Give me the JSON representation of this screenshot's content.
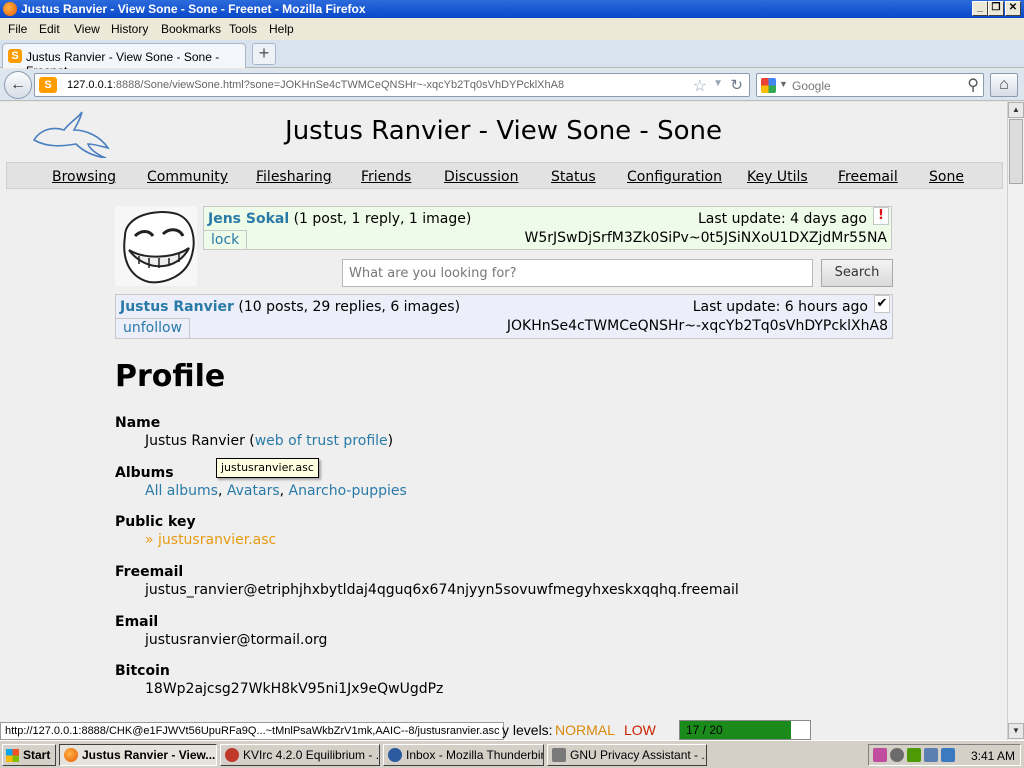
{
  "window": {
    "title": "Justus Ranvier - View Sone - Sone - Freenet - Mozilla Firefox"
  },
  "menu": [
    "File",
    "Edit",
    "View",
    "History",
    "Bookmarks",
    "Tools",
    "Help"
  ],
  "tab": {
    "label": "Justus Ranvier - View Sone - Sone - Freenet"
  },
  "navbar": {
    "url_host": "127.0.0.1",
    "url_rest": ":8888/Sone/viewSone.html?sone=JOKHnSe4cTWMCeQNSHr~-xqcYb2Tq0sVhDYPcklXhA8",
    "search_placeholder": "Google"
  },
  "page": {
    "title": "Justus Ranvier - View Sone - Sone",
    "nav": [
      "Browsing",
      "Community",
      "Filesharing",
      "Friends",
      "Discussion",
      "Status",
      "Configuration",
      "Key Utils",
      "Freemail",
      "Sone"
    ],
    "current_sone": {
      "name": "Jens Sokal",
      "stats": " (1 post, 1 reply, 1 image)",
      "last_update": "Last update: 4 days ago",
      "key": "W5rJSwDjSrfM3Zk0SiPv~0t5JSiNXoU1DXZjdMr55NA",
      "action": "lock",
      "flag": "!"
    },
    "search": {
      "placeholder": "What are you looking for?",
      "button": "Search"
    },
    "viewed_sone": {
      "name": "Justus Ranvier",
      "stats": " (10 posts, 29 replies, 6 images)",
      "last_update": "Last update: 6 hours ago",
      "key": "JOKHnSe4cTWMCeQNSHr~-xqcYb2Tq0sVhDYPcklXhA8",
      "action": "unfollow",
      "flag": "✔"
    },
    "profile": {
      "heading": "Profile",
      "name_label": "Name",
      "name_value": "Justus Ranvier (",
      "name_link": "web of trust profile",
      "name_close": ")",
      "albums_label": "Albums",
      "albums": [
        "All albums",
        "Avatars",
        "Anarcho-puppies"
      ],
      "pubkey_label": "Public key",
      "pubkey_link": "» justusranvier.asc",
      "tooltip": "justusranvier.asc",
      "freemail_label": "Freemail",
      "freemail_value": "justus_ranvier@etriphjhxbytldaj4qguq6x674njyyn5sovuwfmegyhxeskxqqhq.freemail",
      "email_label": "Email",
      "email_value": "justusranvier@tormail.org",
      "bitcoin_label": "Bitcoin",
      "bitcoin_value": "18Wp2ajcsg27WkH8kV95ni1Jx9eQwUgdPz"
    }
  },
  "status": {
    "link_url": "http://127.0.0.1:8888/CHK@e1FJWVt56UpuRFa9Q...~tMnlPsaWkbZrV1mk,AAIC--8/justusranvier.asc",
    "levels_label": "y levels:",
    "normal": "NORMAL",
    "low": "LOW",
    "peers": "17 / 20",
    "peers_fraction": 0.85
  },
  "taskbar": {
    "start": "Start",
    "tasks": [
      "Justus Ranvier - View...",
      "KVIrc 4.2.0 Equilibrium - ...",
      "Inbox - Mozilla Thunderbird",
      "GNU Privacy Assistant - ..."
    ],
    "clock": "3:41 AM"
  },
  "colors": {
    "link": "#2a7aa8",
    "own_sone_bg": "#eefbe8",
    "viewed_sone_bg": "#eceef9",
    "progress": "#1a8a1a"
  }
}
